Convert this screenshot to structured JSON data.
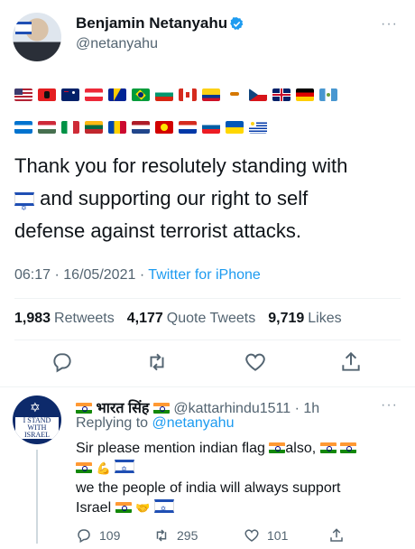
{
  "tweet": {
    "display_name": "Benjamin Netanyahu",
    "handle": "@netanyahu",
    "more": "···",
    "text_line1": "Thank you for resolutely standing with",
    "text_line2_after_flag": " and supporting our right to self",
    "text_line3": "defense against terrorist attacks.",
    "time": "06:17",
    "date": "16/05/2021",
    "separator": "·",
    "source": "Twitter for iPhone"
  },
  "stats": {
    "retweets_count": "1,983",
    "retweets_label": "Retweets",
    "quotes_count": "4,177",
    "quotes_label": "Quote Tweets",
    "likes_count": "9,719",
    "likes_label": "Likes"
  },
  "reply": {
    "name": "भारत सिंह",
    "handle": "@kattarhindu1511",
    "age": "1h",
    "replying_prefix": "Replying to",
    "replying_to": "@netanyahu",
    "line1": "Sir please mention indian flag",
    "line1_after": "also,",
    "line3": "we the people of india will always support",
    "line4": "Israel",
    "avatar_text": "I STAND WITH ISRAEL",
    "reply_count": "109",
    "retweet_count": "295",
    "like_count": "101",
    "more": "···"
  },
  "colors": {
    "link": "#1d9bf0",
    "secondary": "#536471",
    "text": "#0f1419"
  },
  "icons": [
    "verified-badge-icon",
    "reply-icon",
    "retweet-icon",
    "like-icon",
    "share-icon",
    "more-icon"
  ]
}
